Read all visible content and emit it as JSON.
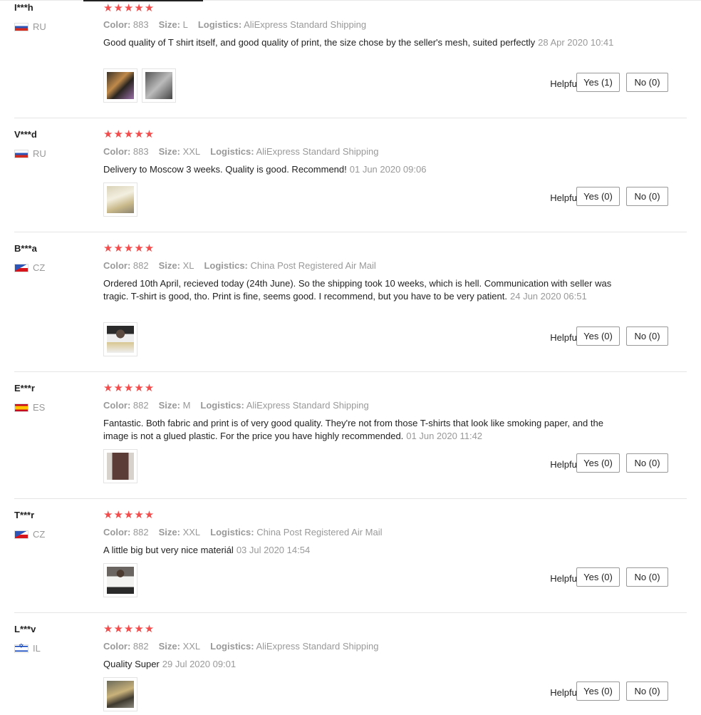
{
  "helpful_label": "Helpful?",
  "colors": {
    "stars": "#f44c4c",
    "muted": "#999999"
  },
  "meta_labels": {
    "color": "Color:",
    "size": "Size:",
    "logistics": "Logistics:"
  },
  "reviews": [
    {
      "user": "I***h",
      "country": "RU",
      "stars": "★★★★★",
      "color": "883",
      "size": "L",
      "logistics": "AliExpress Standard Shipping",
      "text": "Good quality of T shirt itself, and good quality of print, the size chose by the seller's mesh, suited perfectly",
      "date": "28 Apr 2020 10:41",
      "yes": "Yes (1)",
      "no": "No (0)"
    },
    {
      "user": "V***d",
      "country": "RU",
      "stars": "★★★★★",
      "color": "883",
      "size": "XXL",
      "logistics": "AliExpress Standard Shipping",
      "text": "Delivery to Moscow 3 weeks. Quality is good. Recommend!",
      "date": "01 Jun 2020 09:06",
      "yes": "Yes (0)",
      "no": "No (0)"
    },
    {
      "user": "B***a",
      "country": "CZ",
      "stars": "★★★★★",
      "color": "882",
      "size": "XL",
      "logistics": "China Post Registered Air Mail",
      "text": "Ordered 10th April, recieved today (24th June). So the shipping took 10 weeks, which is hell. Communication with seller was tragic. T-shirt is good, tho. Print is fine, seems good. I recommend, but you have to be very patient.",
      "date": "24 Jun 2020 06:51",
      "yes": "Yes (0)",
      "no": "No (0)"
    },
    {
      "user": "E***r",
      "country": "ES",
      "stars": "★★★★★",
      "color": "882",
      "size": "M",
      "logistics": "AliExpress Standard Shipping",
      "text": "Fantastic. Both fabric and print is of very good quality. They're not from those T-shirts that look like smoking paper, and the image is not a glued plastic. For the price you have highly recommended.",
      "date": "01 Jun 2020 11:42",
      "yes": "Yes (0)",
      "no": "No (0)"
    },
    {
      "user": "T***r",
      "country": "CZ",
      "stars": "★★★★★",
      "color": "882",
      "size": "XXL",
      "logistics": "China Post Registered Air Mail",
      "text": "A little big but very nice materiál",
      "date": "03 Jul 2020 14:54",
      "yes": "Yes (0)",
      "no": "No (0)"
    },
    {
      "user": "L***v",
      "country": "IL",
      "stars": "★★★★★",
      "color": "882",
      "size": "XXL",
      "logistics": "AliExpress Standard Shipping",
      "text": "Quality Super",
      "date": "29 Jul 2020 09:01",
      "yes": "Yes (0)",
      "no": "No (0)"
    }
  ]
}
